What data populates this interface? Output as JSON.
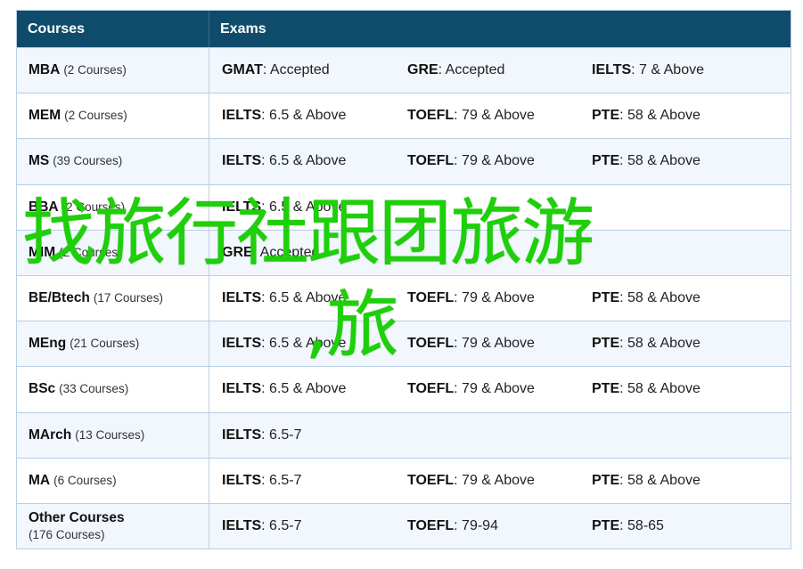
{
  "header": {
    "courses": "Courses",
    "exams": "Exams"
  },
  "rows": [
    {
      "name": "MBA",
      "count": "(2 Courses)",
      "exams": [
        {
          "name": "GMAT",
          "value": ": Accepted"
        },
        {
          "name": "GRE",
          "value": ": Accepted"
        },
        {
          "name": "IELTS",
          "value": ": 7 & Above"
        }
      ]
    },
    {
      "name": "MEM",
      "count": "(2 Courses)",
      "exams": [
        {
          "name": "IELTS",
          "value": ": 6.5 & Above"
        },
        {
          "name": "TOEFL",
          "value": ": 79 & Above"
        },
        {
          "name": "PTE",
          "value": ": 58 & Above"
        }
      ]
    },
    {
      "name": "MS",
      "count": "(39 Courses)",
      "exams": [
        {
          "name": "IELTS",
          "value": ": 6.5 & Above"
        },
        {
          "name": "TOEFL",
          "value": ": 79 & Above"
        },
        {
          "name": "PTE",
          "value": ": 58 & Above"
        }
      ]
    },
    {
      "name": "BBA",
      "count": "(2 Courses)",
      "exams": [
        {
          "name": "IELTS",
          "value": ": 6.5 & Above"
        },
        {
          "name": "",
          "value": ""
        },
        {
          "name": "",
          "value": ""
        }
      ]
    },
    {
      "name": "MIM",
      "count": "(2 Courses)",
      "exams": [
        {
          "name": "GRE",
          "value": ": Accepted"
        },
        {
          "name": "",
          "value": ""
        },
        {
          "name": "",
          "value": ""
        }
      ]
    },
    {
      "name": "BE/Btech",
      "count": "(17 Courses)",
      "exams": [
        {
          "name": "IELTS",
          "value": ": 6.5 & Above"
        },
        {
          "name": "TOEFL",
          "value": ": 79 & Above"
        },
        {
          "name": "PTE",
          "value": ": 58 & Above"
        }
      ]
    },
    {
      "name": "MEng",
      "count": "(21 Courses)",
      "exams": [
        {
          "name": "IELTS",
          "value": ": 6.5 & Above"
        },
        {
          "name": "TOEFL",
          "value": ": 79 & Above"
        },
        {
          "name": "PTE",
          "value": ": 58 & Above"
        }
      ]
    },
    {
      "name": "BSc",
      "count": "(33 Courses)",
      "exams": [
        {
          "name": "IELTS",
          "value": ": 6.5 & Above"
        },
        {
          "name": "TOEFL",
          "value": ": 79 & Above"
        },
        {
          "name": "PTE",
          "value": ": 58 & Above"
        }
      ]
    },
    {
      "name": "MArch",
      "count": "(13 Courses)",
      "exams": [
        {
          "name": "IELTS",
          "value": ": 6.5-7"
        },
        {
          "name": "",
          "value": ""
        },
        {
          "name": "",
          "value": ""
        }
      ]
    },
    {
      "name": "MA",
      "count": "(6 Courses)",
      "exams": [
        {
          "name": "IELTS",
          "value": ": 6.5-7"
        },
        {
          "name": "TOEFL",
          "value": ": 79 & Above"
        },
        {
          "name": "PTE",
          "value": ": 58 & Above"
        }
      ]
    },
    {
      "name": "Other Courses",
      "count": "(176 Courses)",
      "exams": [
        {
          "name": "IELTS",
          "value": ": 6.5-7"
        },
        {
          "name": "TOEFL",
          "value": ": 79-94"
        },
        {
          "name": "PTE",
          "value": ": 58-65"
        }
      ]
    }
  ],
  "overlay": {
    "line1": "找旅行社跟团旅游",
    "line2": ",旅",
    "color": "#1ecf0a"
  }
}
